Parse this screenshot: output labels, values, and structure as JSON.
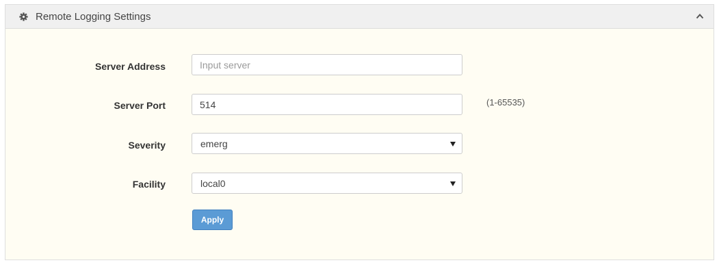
{
  "panel": {
    "title": "Remote Logging Settings",
    "header_icon": "gear-icon",
    "collapse_icon": "chevron-up-icon"
  },
  "form": {
    "server_address": {
      "label": "Server Address",
      "value": "",
      "placeholder": "Input server"
    },
    "server_port": {
      "label": "Server Port",
      "value": "514",
      "hint": "(1-65535)"
    },
    "severity": {
      "label": "Severity",
      "value": "emerg"
    },
    "facility": {
      "label": "Facility",
      "value": "local0"
    },
    "apply_label": "Apply"
  },
  "colors": {
    "panel_background": "#fffdf3",
    "header_background": "#f0f0f0",
    "apply_button": "#5b9bd5"
  }
}
